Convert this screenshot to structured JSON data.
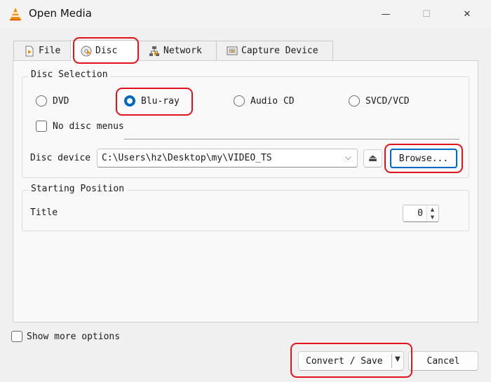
{
  "window": {
    "title": "Open Media",
    "app_icon": "vlc-cone-icon",
    "min_glyph": "—",
    "max_glyph": "☐",
    "close_glyph": "✕"
  },
  "tabs": [
    {
      "label": "File",
      "icon": "file-icon"
    },
    {
      "label": "Disc",
      "icon": "disc-icon",
      "active": true
    },
    {
      "label": "Network",
      "icon": "network-icon"
    },
    {
      "label": "Capture Device",
      "icon": "capture-device-icon"
    }
  ],
  "disc_selection": {
    "heading": "Disc Selection",
    "options": [
      "DVD",
      "Blu-ray",
      "Audio CD",
      "SVCD/VCD"
    ],
    "selected": "Blu-ray",
    "no_disc_menus_label": "No disc menus",
    "no_disc_menus_checked": false,
    "device_label": "Disc device",
    "device_value": "C:\\Users\\hz\\Desktop\\my\\VIDEO_TS",
    "eject_glyph": "⏏",
    "browse_label": "Browse..."
  },
  "starting_position": {
    "heading": "Starting Position",
    "title_label": "Title",
    "title_value": "0"
  },
  "footer": {
    "show_more_label": "Show more options",
    "show_more_checked": false,
    "convert_label": "Convert / Save",
    "cancel_label": "Cancel"
  },
  "colors": {
    "accent": "#0067c0",
    "highlight": "#e3131b"
  }
}
